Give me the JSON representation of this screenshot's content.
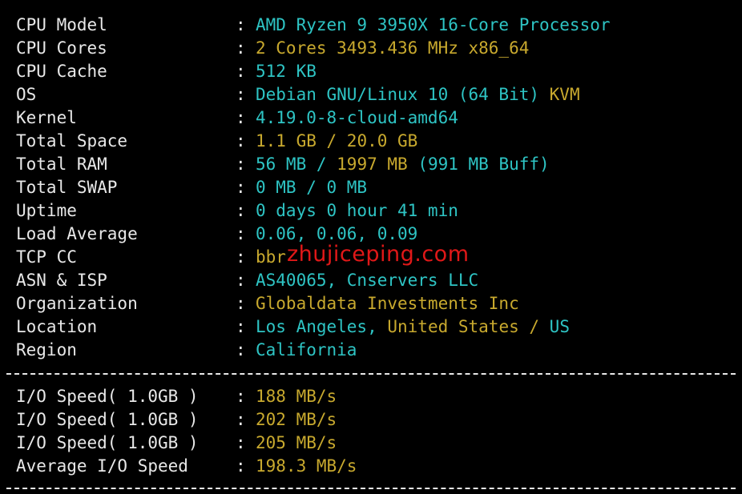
{
  "system_info": [
    {
      "label": "CPU Model",
      "value": [
        {
          "text": "AMD Ryzen 9 3950X 16-Core Processor",
          "color": "cyan"
        }
      ]
    },
    {
      "label": "CPU Cores",
      "value": [
        {
          "text": "2 Cores 3493.436 MHz x86_64",
          "color": "yellow"
        }
      ]
    },
    {
      "label": "CPU Cache",
      "value": [
        {
          "text": "512 KB",
          "color": "cyan"
        }
      ]
    },
    {
      "label": "OS",
      "value": [
        {
          "text": "Debian GNU/Linux 10 (64 Bit) ",
          "color": "cyan"
        },
        {
          "text": "KVM",
          "color": "yellow"
        }
      ]
    },
    {
      "label": "Kernel",
      "value": [
        {
          "text": "4.19.0-8-cloud-amd64",
          "color": "cyan"
        }
      ]
    },
    {
      "label": "Total Space",
      "value": [
        {
          "text": "1.1 GB / ",
          "color": "yellow"
        },
        {
          "text": "20.0 GB",
          "color": "yellow"
        }
      ]
    },
    {
      "label": "Total RAM",
      "value": [
        {
          "text": "56 MB / ",
          "color": "cyan"
        },
        {
          "text": "1997 MB",
          "color": "yellow"
        },
        {
          "text": " (991 MB Buff)",
          "color": "cyan"
        }
      ]
    },
    {
      "label": "Total SWAP",
      "value": [
        {
          "text": "0 MB / 0 MB",
          "color": "cyan"
        }
      ]
    },
    {
      "label": "Uptime",
      "value": [
        {
          "text": "0 days 0 hour 41 min",
          "color": "cyan"
        }
      ]
    },
    {
      "label": "Load Average",
      "value": [
        {
          "text": "0.06, 0.06, 0.09",
          "color": "cyan"
        }
      ]
    },
    {
      "label": "TCP CC",
      "value": [
        {
          "text": "bbr",
          "color": "yellow"
        }
      ]
    },
    {
      "label": "ASN & ISP",
      "value": [
        {
          "text": "AS40065, Cnservers LLC",
          "color": "cyan"
        }
      ]
    },
    {
      "label": "Organization",
      "value": [
        {
          "text": "Globaldata Investments Inc",
          "color": "yellow"
        }
      ]
    },
    {
      "label": "Location",
      "value": [
        {
          "text": "Los Angeles, ",
          "color": "cyan"
        },
        {
          "text": "United States / ",
          "color": "yellow"
        },
        {
          "text": "US",
          "color": "cyan"
        }
      ]
    },
    {
      "label": "Region",
      "value": [
        {
          "text": "California",
          "color": "cyan"
        }
      ]
    }
  ],
  "io_info": [
    {
      "label": "I/O Speed( 1.0GB )",
      "value": [
        {
          "text": "188 MB/s",
          "color": "yellow"
        }
      ]
    },
    {
      "label": "I/O Speed( 1.0GB )",
      "value": [
        {
          "text": "202 MB/s",
          "color": "yellow"
        }
      ]
    },
    {
      "label": "I/O Speed( 1.0GB )",
      "value": [
        {
          "text": "205 MB/s",
          "color": "yellow"
        }
      ]
    },
    {
      "label": "Average I/O Speed",
      "value": [
        {
          "text": "198.3 MB/s",
          "color": "yellow"
        }
      ]
    }
  ],
  "separator": ":",
  "watermark": "zhujiceping.com",
  "colors": {
    "background": "#000000",
    "text": "#e8e8e8",
    "cyan": "#2ec4c4",
    "yellow": "#c8a92e",
    "watermark": "#e01818"
  }
}
